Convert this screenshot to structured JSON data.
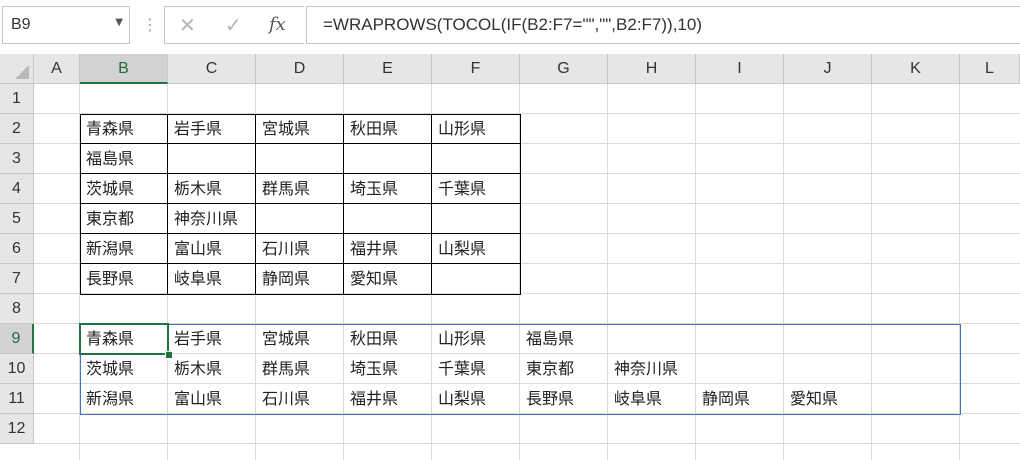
{
  "name_box": {
    "value": "B9"
  },
  "formula_bar": {
    "formula": "=WRAPROWS(TOCOL(IF(B2:F7=\"\",\"\",B2:F7)),10)",
    "cancel_icon": "✕",
    "enter_icon": "✓",
    "fx_label": "fx"
  },
  "columns": [
    "A",
    "B",
    "C",
    "D",
    "E",
    "F",
    "G",
    "H",
    "I",
    "J",
    "K",
    "L"
  ],
  "rows": [
    "1",
    "2",
    "3",
    "4",
    "5",
    "6",
    "7",
    "8",
    "9",
    "10",
    "11",
    "12"
  ],
  "active_cell": {
    "column": "B",
    "row": "9"
  },
  "source_table": [
    [
      "青森県",
      "岩手県",
      "宮城県",
      "秋田県",
      "山形県"
    ],
    [
      "福島県",
      "",
      "",
      "",
      ""
    ],
    [
      "茨城県",
      "栃木県",
      "群馬県",
      "埼玉県",
      "千葉県"
    ],
    [
      "東京都",
      "神奈川県",
      "",
      "",
      ""
    ],
    [
      "新潟県",
      "富山県",
      "石川県",
      "福井県",
      "山梨県"
    ],
    [
      "長野県",
      "岐阜県",
      "静岡県",
      "愛知県",
      ""
    ]
  ],
  "spill_result": [
    [
      "青森県",
      "岩手県",
      "宮城県",
      "秋田県",
      "山形県",
      "福島県",
      "",
      "",
      "",
      ""
    ],
    [
      "茨城県",
      "栃木県",
      "群馬県",
      "埼玉県",
      "千葉県",
      "東京都",
      "神奈川県",
      "",
      "",
      ""
    ],
    [
      "新潟県",
      "富山県",
      "石川県",
      "福井県",
      "山梨県",
      "長野県",
      "岐阜県",
      "静岡県",
      "愛知県",
      ""
    ]
  ],
  "colors": {
    "selection_green": "#217346",
    "spill_blue": "#4472c4",
    "header_gray": "#e6e6e6"
  }
}
